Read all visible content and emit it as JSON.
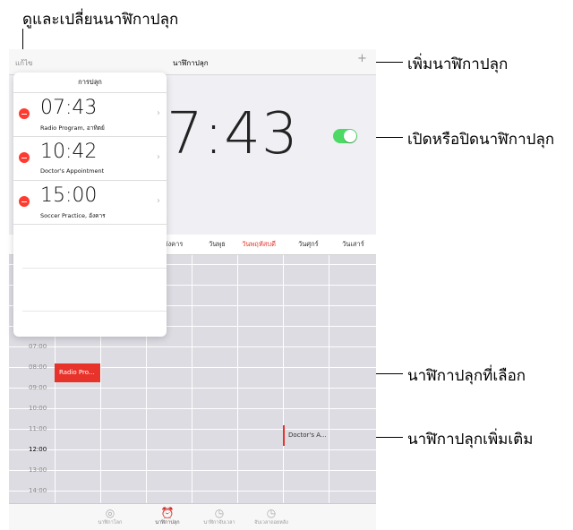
{
  "callouts": {
    "view_change": "ดูและเปลี่ยนนาฬิกาปลุก",
    "add_alarm": "เพิ่มนาฬิกาปลุก",
    "toggle_alarm": "เปิดหรือปิดนาฬิกาปลุก",
    "selected_alarm": "นาฬิกาปลุกที่เลือก",
    "more_alarms": "นาฬิกาปลุกเพิ่มเติม"
  },
  "navbar": {
    "edit_label": "แก้ไข",
    "title": "นาฬิกาปลุก",
    "add_label": "+"
  },
  "main": {
    "big_time": "7:43",
    "toggle_on": true
  },
  "days": [
    "อังคาร",
    "วันพุธ",
    "วันพฤหัสบดี",
    "วันศุกร์",
    "วันเสาร์"
  ],
  "highlight_day": "วันพฤหัสบดี",
  "hours": [
    "07:00",
    "08:00",
    "09:00",
    "10:00",
    "11:00",
    "12:00",
    "13:00",
    "14:00"
  ],
  "events": {
    "radio": "Radio Pro...",
    "doctor": "Doctor's A..."
  },
  "popover": {
    "title": "การปลุก",
    "alarms": [
      {
        "time": "07:43",
        "label": "Radio Program, อาทิตย์"
      },
      {
        "time": "10:42",
        "label": "Doctor's Appointment"
      },
      {
        "time": "15:00",
        "label": "Soccer Practice, อังคาร"
      }
    ]
  },
  "tabs": [
    {
      "label": "นาฬิกาโลก",
      "icon": "globe-icon"
    },
    {
      "label": "นาฬิกาปลุก",
      "icon": "alarm-clock-icon"
    },
    {
      "label": "นาฬิกาจับเวลา",
      "icon": "stopwatch-icon"
    },
    {
      "label": "จับเวลาถอยหลัง",
      "icon": "timer-icon"
    }
  ],
  "colors": {
    "accent_red": "#e8332b",
    "toggle_green": "#4cd964"
  }
}
